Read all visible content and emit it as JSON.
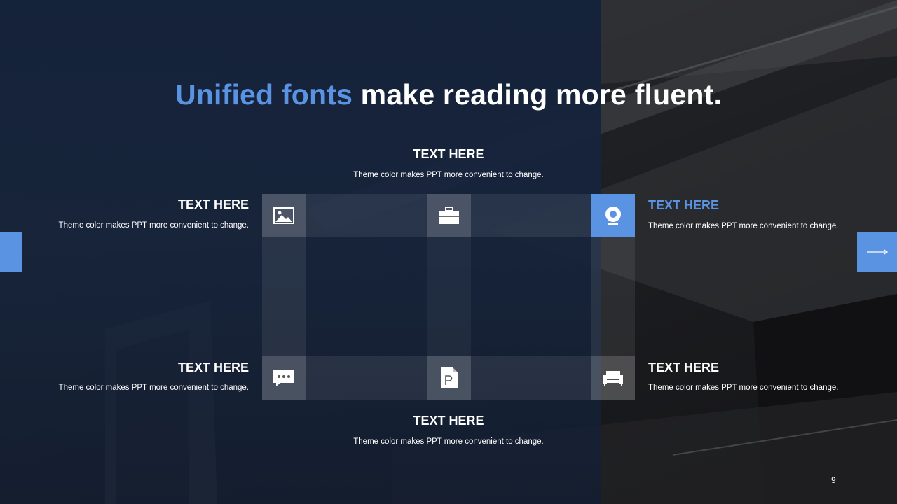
{
  "title": {
    "highlight": "Unified fonts",
    "rest": "make reading more fluent."
  },
  "blocks": {
    "top": {
      "title": "TEXT HERE",
      "desc": "Theme  color makes PPT more convenient to change."
    },
    "left_top": {
      "title": "TEXT HERE",
      "desc": "Theme  color makes PPT more convenient to change."
    },
    "right_top": {
      "title": "TEXT HERE",
      "desc": "Theme  color makes PPT more convenient to change."
    },
    "left_bottom": {
      "title": "TEXT HERE",
      "desc": "Theme  color makes PPT more convenient to change."
    },
    "right_bottom": {
      "title": "TEXT HERE",
      "desc": "Theme  color makes PPT more convenient to change."
    },
    "bottom": {
      "title": "TEXT HERE",
      "desc": "Theme  color makes PPT more convenient to change."
    }
  },
  "icons": [
    "image-icon",
    "briefcase-icon",
    "webcam-icon",
    "chat-bubble-icon",
    "document-p-icon",
    "sofa-icon"
  ],
  "colors": {
    "accent": "#5b93e3",
    "text": "#ffffff",
    "navy": "#14223a"
  },
  "page_number": "9"
}
